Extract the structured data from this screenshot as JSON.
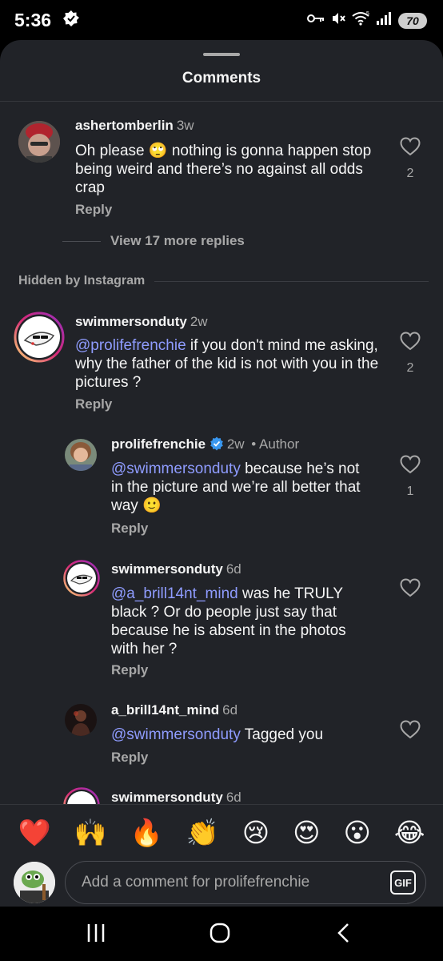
{
  "status_bar": {
    "time": "5:36",
    "battery": "70",
    "network_label": "5"
  },
  "sheet": {
    "title": "Comments"
  },
  "comments": [
    {
      "user": "ashertomberlin",
      "time": "3w",
      "text_a": "Oh please ",
      "emoji": "🙄",
      "text_b": " nothing is gonna happen stop being weird and there’s no against all odds crap",
      "reply": "Reply",
      "likes": "2"
    },
    {
      "user": "swimmersonduty",
      "time": "2w",
      "mention": "@prolifefrenchie",
      "text": " if you don't mind me asking, why the father of the kid is not with you in the pictures ?",
      "reply": "Reply",
      "likes": "2"
    },
    {
      "user": "prolifefrenchie",
      "time": "2w",
      "author_tag": "• Author",
      "mention": "@swimmersonduty",
      "text": " because he’s not in the picture and we’re all better that way ",
      "emoji": "🙂",
      "reply": "Reply",
      "likes": "1"
    },
    {
      "user": "swimmersonduty",
      "time": "6d",
      "mention": "@a_brill14nt_mind",
      "text": " was he TRULY black ? Or do people just say that because he is absent in the photos with her ?",
      "reply": "Reply"
    },
    {
      "user": "a_brill14nt_mind",
      "time": "6d",
      "mention": "@swimmersonduty",
      "text": " Tagged you",
      "reply": "Reply"
    },
    {
      "user": "swimmersonduty",
      "time": "6d"
    }
  ],
  "view_more": "View 17 more replies",
  "hidden_label": "Hidden by Instagram",
  "emoji_bar": [
    "❤️",
    "🙌",
    "🔥",
    "👏",
    "😢",
    "😍",
    "😮",
    "😂"
  ],
  "composer": {
    "placeholder": "Add a comment for prolifefrenchie",
    "gif_label": "GIF"
  },
  "colors": {
    "background": "#212328",
    "mention": "#8f9cff",
    "muted": "#a8a8a8",
    "verified": "#3897f0",
    "story_ring": "#d62976"
  },
  "icons": [
    "verified-badge-icon",
    "heart-outline-icon",
    "key-icon",
    "mute-icon",
    "wifi-icon",
    "signal-icon",
    "recents-icon",
    "home-icon",
    "back-icon"
  ]
}
